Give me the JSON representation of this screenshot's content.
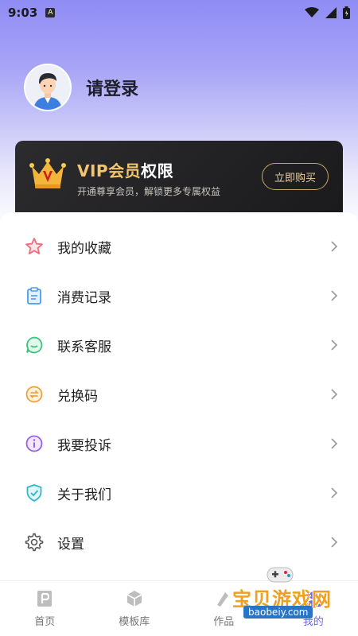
{
  "status_bar": {
    "time": "9:03",
    "notif_letter": "A"
  },
  "profile": {
    "login_label": "请登录"
  },
  "vip": {
    "title_highlight": "VIP会员",
    "title_plain": "权限",
    "subtitle": "开通尊享会员，解锁更多专属权益",
    "buy_label": "立即购买",
    "accent_color": "#f3c56c"
  },
  "menu": [
    {
      "label": "我的收藏",
      "icon": "star-icon"
    },
    {
      "label": "消费记录",
      "icon": "clipboard-icon"
    },
    {
      "label": "联系客服",
      "icon": "chat-icon"
    },
    {
      "label": "兑换码",
      "icon": "exchange-icon"
    },
    {
      "label": "我要投诉",
      "icon": "info-icon"
    },
    {
      "label": "关于我们",
      "icon": "shield-check-icon"
    },
    {
      "label": "设置",
      "icon": "gear-icon"
    }
  ],
  "bottom_nav": [
    {
      "label": "首页",
      "icon": "home-p-icon"
    },
    {
      "label": "模板库",
      "icon": "box-icon"
    },
    {
      "label": "作品",
      "icon": "works-icon"
    },
    {
      "label": "我的",
      "icon": "profile-icon",
      "active": true
    }
  ],
  "watermark": {
    "text": "宝贝游戏网",
    "url": "baobeiy.com"
  }
}
